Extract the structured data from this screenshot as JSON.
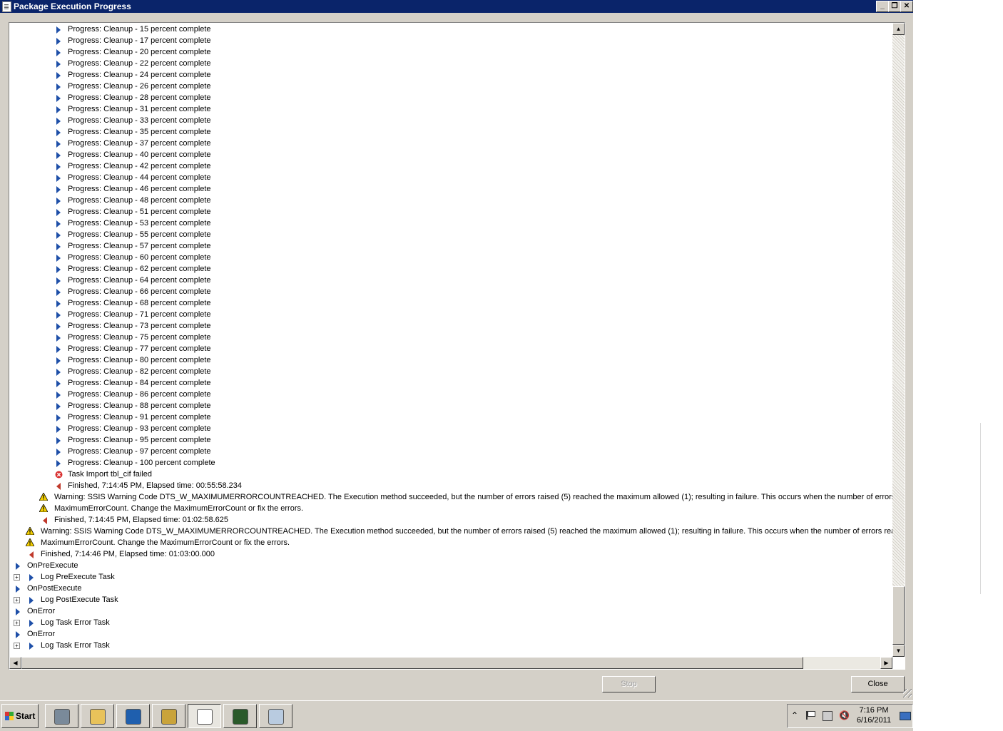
{
  "window": {
    "title": "Package Execution Progress",
    "minimize_label": "_",
    "restore_label": "❐",
    "close_label": "✕"
  },
  "log": {
    "lines": [
      {
        "level": 3,
        "icon": "progress",
        "text": "Progress: Cleanup - 15 percent complete"
      },
      {
        "level": 3,
        "icon": "progress",
        "text": "Progress: Cleanup - 17 percent complete"
      },
      {
        "level": 3,
        "icon": "progress",
        "text": "Progress: Cleanup - 20 percent complete"
      },
      {
        "level": 3,
        "icon": "progress",
        "text": "Progress: Cleanup - 22 percent complete"
      },
      {
        "level": 3,
        "icon": "progress",
        "text": "Progress: Cleanup - 24 percent complete"
      },
      {
        "level": 3,
        "icon": "progress",
        "text": "Progress: Cleanup - 26 percent complete"
      },
      {
        "level": 3,
        "icon": "progress",
        "text": "Progress: Cleanup - 28 percent complete"
      },
      {
        "level": 3,
        "icon": "progress",
        "text": "Progress: Cleanup - 31 percent complete"
      },
      {
        "level": 3,
        "icon": "progress",
        "text": "Progress: Cleanup - 33 percent complete"
      },
      {
        "level": 3,
        "icon": "progress",
        "text": "Progress: Cleanup - 35 percent complete"
      },
      {
        "level": 3,
        "icon": "progress",
        "text": "Progress: Cleanup - 37 percent complete"
      },
      {
        "level": 3,
        "icon": "progress",
        "text": "Progress: Cleanup - 40 percent complete"
      },
      {
        "level": 3,
        "icon": "progress",
        "text": "Progress: Cleanup - 42 percent complete"
      },
      {
        "level": 3,
        "icon": "progress",
        "text": "Progress: Cleanup - 44 percent complete"
      },
      {
        "level": 3,
        "icon": "progress",
        "text": "Progress: Cleanup - 46 percent complete"
      },
      {
        "level": 3,
        "icon": "progress",
        "text": "Progress: Cleanup - 48 percent complete"
      },
      {
        "level": 3,
        "icon": "progress",
        "text": "Progress: Cleanup - 51 percent complete"
      },
      {
        "level": 3,
        "icon": "progress",
        "text": "Progress: Cleanup - 53 percent complete"
      },
      {
        "level": 3,
        "icon": "progress",
        "text": "Progress: Cleanup - 55 percent complete"
      },
      {
        "level": 3,
        "icon": "progress",
        "text": "Progress: Cleanup - 57 percent complete"
      },
      {
        "level": 3,
        "icon": "progress",
        "text": "Progress: Cleanup - 60 percent complete"
      },
      {
        "level": 3,
        "icon": "progress",
        "text": "Progress: Cleanup - 62 percent complete"
      },
      {
        "level": 3,
        "icon": "progress",
        "text": "Progress: Cleanup - 64 percent complete"
      },
      {
        "level": 3,
        "icon": "progress",
        "text": "Progress: Cleanup - 66 percent complete"
      },
      {
        "level": 3,
        "icon": "progress",
        "text": "Progress: Cleanup - 68 percent complete"
      },
      {
        "level": 3,
        "icon": "progress",
        "text": "Progress: Cleanup - 71 percent complete"
      },
      {
        "level": 3,
        "icon": "progress",
        "text": "Progress: Cleanup - 73 percent complete"
      },
      {
        "level": 3,
        "icon": "progress",
        "text": "Progress: Cleanup - 75 percent complete"
      },
      {
        "level": 3,
        "icon": "progress",
        "text": "Progress: Cleanup - 77 percent complete"
      },
      {
        "level": 3,
        "icon": "progress",
        "text": "Progress: Cleanup - 80 percent complete"
      },
      {
        "level": 3,
        "icon": "progress",
        "text": "Progress: Cleanup - 82 percent complete"
      },
      {
        "level": 3,
        "icon": "progress",
        "text": "Progress: Cleanup - 84 percent complete"
      },
      {
        "level": 3,
        "icon": "progress",
        "text": "Progress: Cleanup - 86 percent complete"
      },
      {
        "level": 3,
        "icon": "progress",
        "text": "Progress: Cleanup - 88 percent complete"
      },
      {
        "level": 3,
        "icon": "progress",
        "text": "Progress: Cleanup - 91 percent complete"
      },
      {
        "level": 3,
        "icon": "progress",
        "text": "Progress: Cleanup - 93 percent complete"
      },
      {
        "level": 3,
        "icon": "progress",
        "text": "Progress: Cleanup - 95 percent complete"
      },
      {
        "level": 3,
        "icon": "progress",
        "text": "Progress: Cleanup - 97 percent complete"
      },
      {
        "level": 3,
        "icon": "progress",
        "text": "Progress: Cleanup - 100 percent complete"
      },
      {
        "level": 3,
        "icon": "error",
        "text": "Task Import tbl_cif failed"
      },
      {
        "level": 3,
        "icon": "finished",
        "text": "Finished, 7:14:45 PM, Elapsed time: 00:55:58.234"
      },
      {
        "level": 2,
        "icon": "warning",
        "text": "Warning: SSIS Warning Code DTS_W_MAXIMUMERRORCOUNTREACHED.  The Execution method succeeded, but the number of errors raised (5) reached the maximum allowed (1); resulting in failure. This occurs when the number of errors reaches the number specified in"
      },
      {
        "level": 2,
        "icon": "warning",
        "text": "MaximumErrorCount. Change the MaximumErrorCount or fix the errors."
      },
      {
        "level": 2,
        "icon": "finished",
        "text": "Finished, 7:14:45 PM, Elapsed time: 01:02:58.625"
      },
      {
        "level": 1,
        "icon": "warning",
        "text": "Warning: SSIS Warning Code DTS_W_MAXIMUMERRORCOUNTREACHED.  The Execution method succeeded, but the number of errors raised (5) reached the maximum allowed (1); resulting in failure. This occurs when the number of errors reaches the number specified in"
      },
      {
        "level": 1,
        "icon": "warning",
        "text": "MaximumErrorCount. Change the MaximumErrorCount or fix the errors."
      },
      {
        "level": 1,
        "icon": "finished",
        "text": "Finished, 7:14:46 PM, Elapsed time: 01:03:00.000"
      },
      {
        "level": 0,
        "icon": "progress",
        "text": "OnPreExecute"
      },
      {
        "level": 1,
        "icon": "progress",
        "expander": true,
        "text": "Log PreExecute Task"
      },
      {
        "level": 0,
        "icon": "progress",
        "text": "OnPostExecute"
      },
      {
        "level": 1,
        "icon": "progress",
        "expander": true,
        "text": "Log PostExecute Task"
      },
      {
        "level": 0,
        "icon": "progress",
        "text": "OnError"
      },
      {
        "level": 1,
        "icon": "progress",
        "expander": true,
        "text": "Log Task Error Task"
      },
      {
        "level": 0,
        "icon": "progress",
        "text": "OnError"
      },
      {
        "level": 1,
        "icon": "progress",
        "expander": true,
        "text": "Log Task Error Task"
      }
    ]
  },
  "buttons": {
    "stop_label": "Stop",
    "close_label": "Close"
  },
  "taskbar": {
    "start_label": "Start",
    "apps": [
      {
        "name": "server-manager-icon"
      },
      {
        "name": "explorer-icon"
      },
      {
        "name": "powershell-icon"
      },
      {
        "name": "ssms-icon"
      },
      {
        "name": "package-execution-icon"
      },
      {
        "name": "monitor-icon"
      },
      {
        "name": "paint-icon"
      }
    ],
    "tray": {
      "show_hidden_label": "⌃",
      "time": "7:16 PM",
      "date": "6/16/2011"
    }
  },
  "colors": {
    "titlebar": "#0a246a",
    "progress_arrow": "#1e4fa8",
    "finished_arrow": "#c0392b",
    "warning": "#f5d000",
    "error": "#d93030"
  }
}
